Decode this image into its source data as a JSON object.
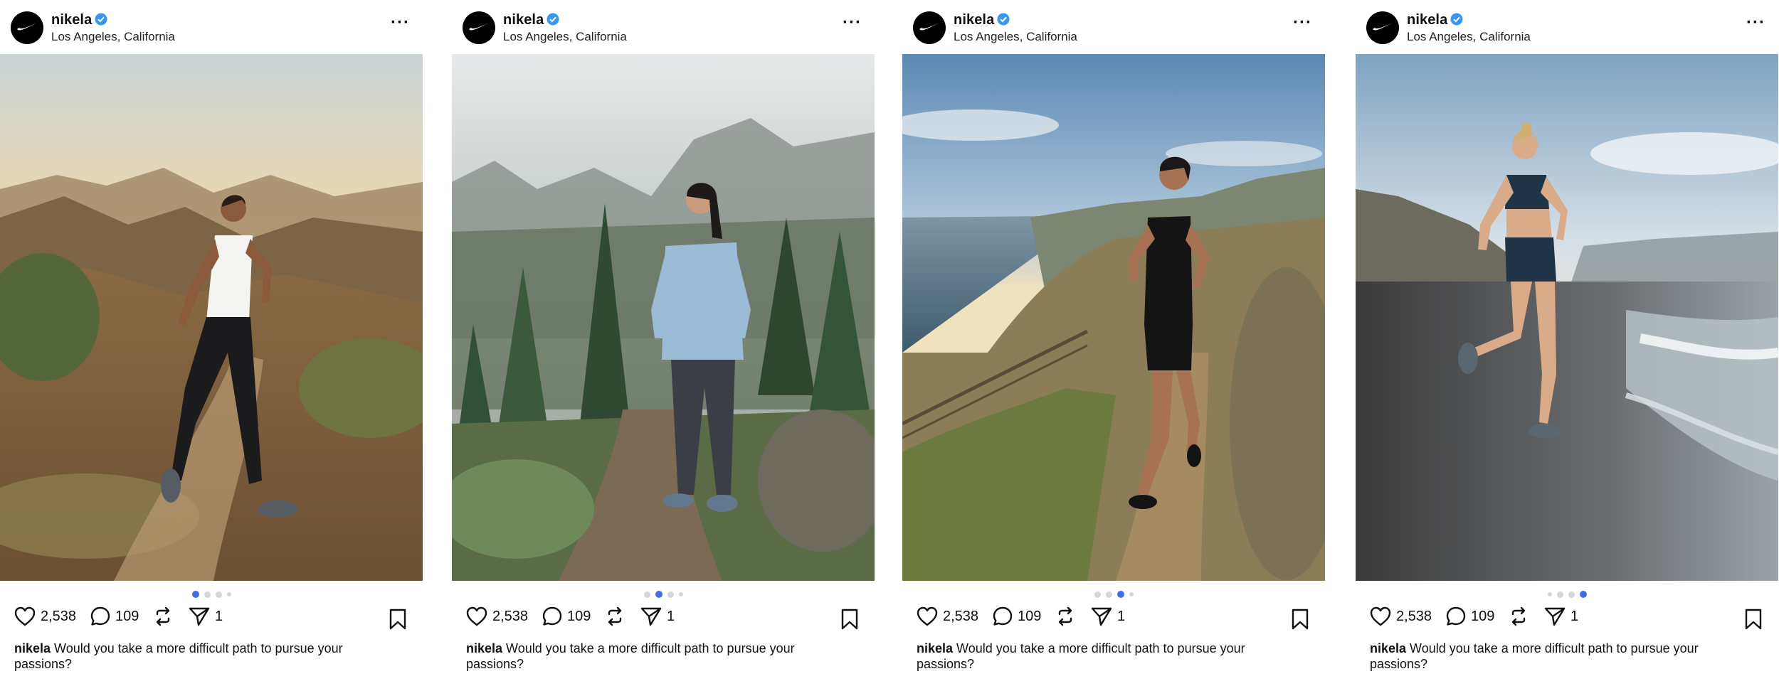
{
  "colors": {
    "accent": "#3f6fe5",
    "verified": "#3897f0",
    "icon": "#111111"
  },
  "posts": [
    {
      "username": "nikela",
      "location": "Los Angeles, California",
      "more_label": "···",
      "likes": "2,538",
      "comments": "109",
      "shares": "1",
      "caption_user": "nikela",
      "caption_text": "Would you take a more difficult path to pursue your passions?",
      "carousel_index": 1,
      "carousel_count": 4,
      "photo_icon": "photo-trail-runner-man"
    },
    {
      "username": "nikela",
      "location": "Los Angeles, California",
      "more_label": "···",
      "likes": "2,538",
      "comments": "109",
      "shares": "1",
      "caption_user": "nikela",
      "caption_text": "Would you take a more difficult path to pursue your passions?",
      "carousel_index": 2,
      "carousel_count": 4,
      "photo_icon": "photo-hiker-woman-forest"
    },
    {
      "username": "nikela",
      "location": "Los Angeles, California",
      "more_label": "···",
      "likes": "2,538",
      "comments": "109",
      "shares": "1",
      "caption_user": "nikela",
      "caption_text": "Would you take a more difficult path to pursue your passions?",
      "carousel_index": 3,
      "carousel_count": 4,
      "photo_icon": "photo-coastal-runner"
    },
    {
      "username": "nikela",
      "location": "Los Angeles, California",
      "more_label": "···",
      "likes": "2,538",
      "comments": "109",
      "shares": "1",
      "caption_user": "nikela",
      "caption_text": "Would you take a more difficult path to pursue your passions?",
      "carousel_index": 4,
      "carousel_count": 4,
      "photo_icon": "photo-beach-runner-woman"
    }
  ]
}
